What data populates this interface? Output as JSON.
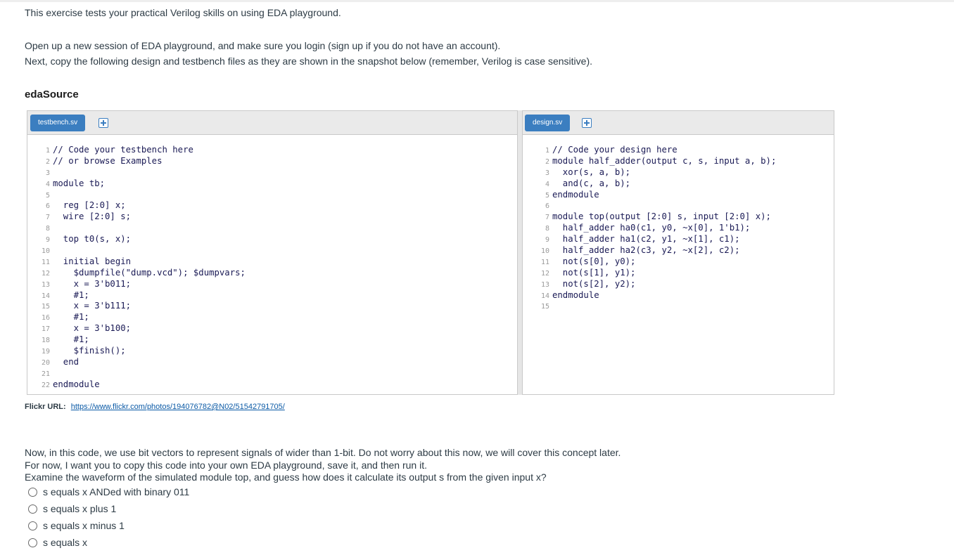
{
  "intro": {
    "line1": "This exercise tests your practical Verilog skills on using EDA playground.",
    "line2": "Open up a new session of EDA playground, and make sure you login (sign up if you do not have an account).",
    "line3": "Next, copy the following design and testbench files as they are shown in the snapshot below (remember, Verilog is case sensitive)."
  },
  "heading": "edaSource",
  "editor": {
    "left_tab": "testbench.sv",
    "right_tab": "design.sv",
    "testbench_lines": [
      {
        "n": "1",
        "t": "// Code your testbench here"
      },
      {
        "n": "2",
        "t": "// or browse Examples"
      },
      {
        "n": "3",
        "t": ""
      },
      {
        "n": "4",
        "t": "module tb;"
      },
      {
        "n": "5",
        "t": ""
      },
      {
        "n": "6",
        "t": "  reg [2:0] x;"
      },
      {
        "n": "7",
        "t": "  wire [2:0] s;"
      },
      {
        "n": "8",
        "t": ""
      },
      {
        "n": "9",
        "t": "  top t0(s, x);"
      },
      {
        "n": "10",
        "t": ""
      },
      {
        "n": "11",
        "t": "  initial begin"
      },
      {
        "n": "12",
        "t": "    $dumpfile(\"dump.vcd\"); $dumpvars;"
      },
      {
        "n": "13",
        "t": "    x = 3'b011;"
      },
      {
        "n": "14",
        "t": "    #1;"
      },
      {
        "n": "15",
        "t": "    x = 3'b111;"
      },
      {
        "n": "16",
        "t": "    #1;"
      },
      {
        "n": "17",
        "t": "    x = 3'b100;"
      },
      {
        "n": "18",
        "t": "    #1;"
      },
      {
        "n": "19",
        "t": "    $finish();"
      },
      {
        "n": "20",
        "t": "  end"
      },
      {
        "n": "21",
        "t": ""
      },
      {
        "n": "22",
        "t": "endmodule"
      }
    ],
    "design_lines": [
      {
        "n": "1",
        "t": "// Code your design here"
      },
      {
        "n": "2",
        "t": "module half_adder(output c, s, input a, b);"
      },
      {
        "n": "3",
        "t": "  xor(s, a, b);"
      },
      {
        "n": "4",
        "t": "  and(c, a, b);"
      },
      {
        "n": "5",
        "t": "endmodule"
      },
      {
        "n": "6",
        "t": ""
      },
      {
        "n": "7",
        "t": "module top(output [2:0] s, input [2:0] x);"
      },
      {
        "n": "8",
        "t": "  half_adder ha0(c1, y0, ~x[0], 1'b1);"
      },
      {
        "n": "9",
        "t": "  half_adder ha1(c2, y1, ~x[1], c1);"
      },
      {
        "n": "10",
        "t": "  half_adder ha2(c3, y2, ~x[2], c2);"
      },
      {
        "n": "11",
        "t": "  not(s[0], y0);"
      },
      {
        "n": "12",
        "t": "  not(s[1], y1);"
      },
      {
        "n": "13",
        "t": "  not(s[2], y2);"
      },
      {
        "n": "14",
        "t": "endmodule"
      },
      {
        "n": "15",
        "t": ""
      }
    ]
  },
  "flickr": {
    "label": "Flickr URL:",
    "url": "https://www.flickr.com/photos/194076782@N02/51542791705/"
  },
  "question": {
    "line1": "Now, in this code, we use bit vectors to represent signals of wider than 1-bit. Do not worry about this now, we will cover this concept later.",
    "line2": "For now, I want you to copy this code into your own EDA playground, save it, and then run it.",
    "line3": "Examine the waveform of the simulated module top, and guess how does it calculate its output s from the given input x?",
    "options": [
      "s equals x ANDed with binary 011",
      "s equals x plus 1",
      "s equals x minus 1",
      "s equals x"
    ]
  }
}
